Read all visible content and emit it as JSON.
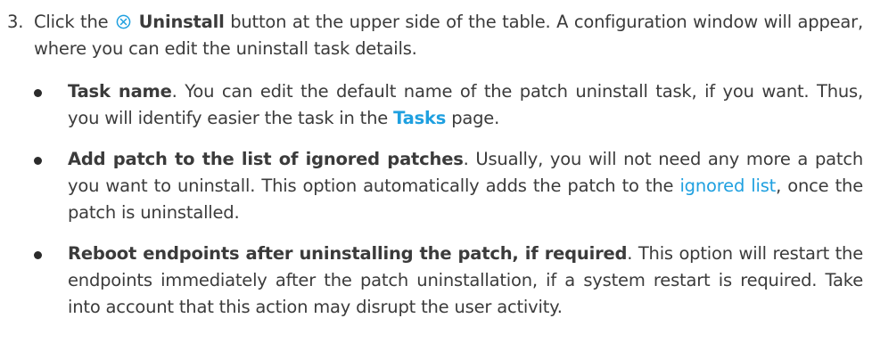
{
  "step": {
    "number": "3.",
    "before_icon": "Click the ",
    "icon": "uninstall-circle-x-icon",
    "button_label": "Uninstall",
    "after_button": " button at the upper side of the table. A configuration window will appear, where you can edit the uninstall task details."
  },
  "options": [
    {
      "title": "Task name",
      "text_1": ". You can edit the default name of the patch uninstall task, if you want. Thus, you will identify easier the task in the ",
      "link": "Tasks",
      "text_2": " page."
    },
    {
      "title": "Add patch to the list of ignored patches",
      "text_1": ". Usually, you will not need any more a patch you want to uninstall. This option automatically adds the patch to the ",
      "link": "ignored list",
      "text_2": ", once the patch is uninstalled."
    },
    {
      "title": "Reboot endpoints after uninstalling the patch, if required",
      "text_1": ". This option will restart the endpoints immediately after the patch uninstallation, if a system restart is required. Take into account that this action may disrupt the user activity."
    }
  ],
  "colors": {
    "link": "#1fa0e0",
    "text": "#3b3b3b"
  }
}
